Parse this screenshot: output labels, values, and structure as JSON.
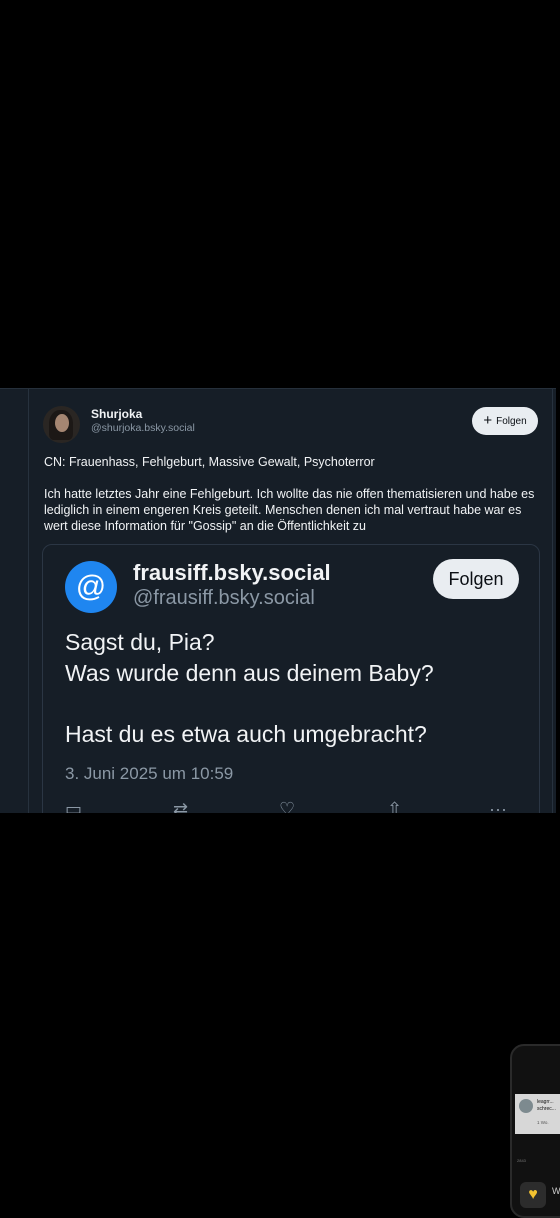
{
  "post": {
    "author_name": "Shurjoka",
    "author_handle": "@shurjoka.bsky.social",
    "follow_label": "Folgen",
    "content_warning": "CN: Frauenhass, Fehlgeburt, Massive Gewalt, Psychoterror",
    "body": "Ich hatte letztes Jahr eine Fehlgeburt. Ich wollte das nie offen thematisieren und habe es lediglich in einem engeren Kreis geteilt. Menschen denen ich mal vertraut habe war es wert diese Information für \"Gossip\" an die Öffentlichkeit zu"
  },
  "embed": {
    "author_name": "frausiff.bsky.social",
    "author_handle": "@frausiff.bsky.social",
    "avatar_glyph": "@",
    "follow_label": "Folgen",
    "lines": [
      "Sagst du, Pia?",
      "Was wurde denn aus deinem Baby?",
      "Hast du es etwa auch umgebracht?"
    ],
    "date": "3. Juni 2025 um 10:59"
  },
  "phone_preview": {
    "line1": "leagrr...",
    "line2": "schrec...",
    "time": "1 Wo.",
    "small": "2843",
    "cut_text": "W"
  },
  "icons": {
    "plus": "plus-icon",
    "reply": "reply-icon",
    "repost": "repost-icon",
    "like": "heart-icon",
    "share": "share-icon",
    "more": "more-icon"
  },
  "colors": {
    "background": "#000000",
    "card": "#161e27",
    "accent": "#1f86f0",
    "muted_text": "#8b98a5"
  }
}
